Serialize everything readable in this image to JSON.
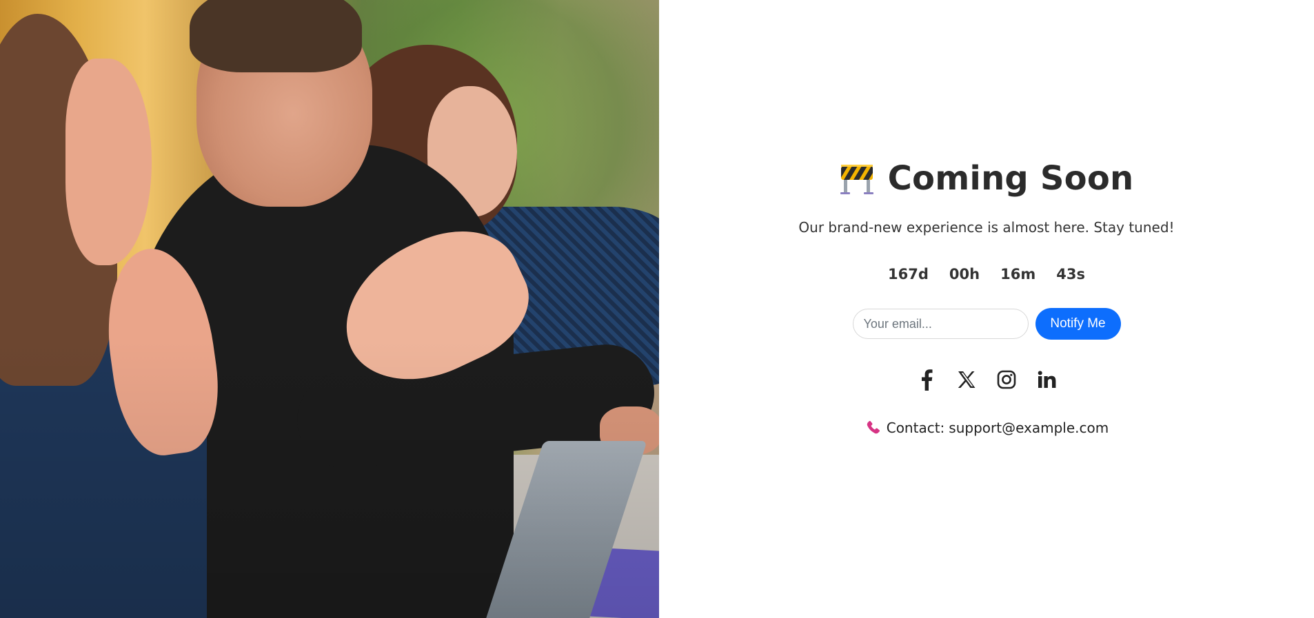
{
  "hero_image": {
    "icon": "team-meeting-photo"
  },
  "header": {
    "emoji_icon": "construction-barrier-icon",
    "title": "Coming Soon",
    "subtitle": "Our brand-new experience is almost here. Stay tuned!"
  },
  "countdown": {
    "days": "167d",
    "hours": "00h",
    "minutes": "16m",
    "seconds": "43s"
  },
  "notify_form": {
    "email_placeholder": "Your email...",
    "email_value": "",
    "button_label": "Notify Me",
    "button_color": "#0d6efd"
  },
  "social": {
    "items": [
      {
        "icon": "facebook-icon"
      },
      {
        "icon": "x-twitter-icon"
      },
      {
        "icon": "instagram-icon"
      },
      {
        "icon": "linkedin-icon"
      }
    ]
  },
  "contact": {
    "icon": "phone-icon",
    "icon_color": "#d63384",
    "label": "Contact:",
    "email": "support@example.com"
  }
}
